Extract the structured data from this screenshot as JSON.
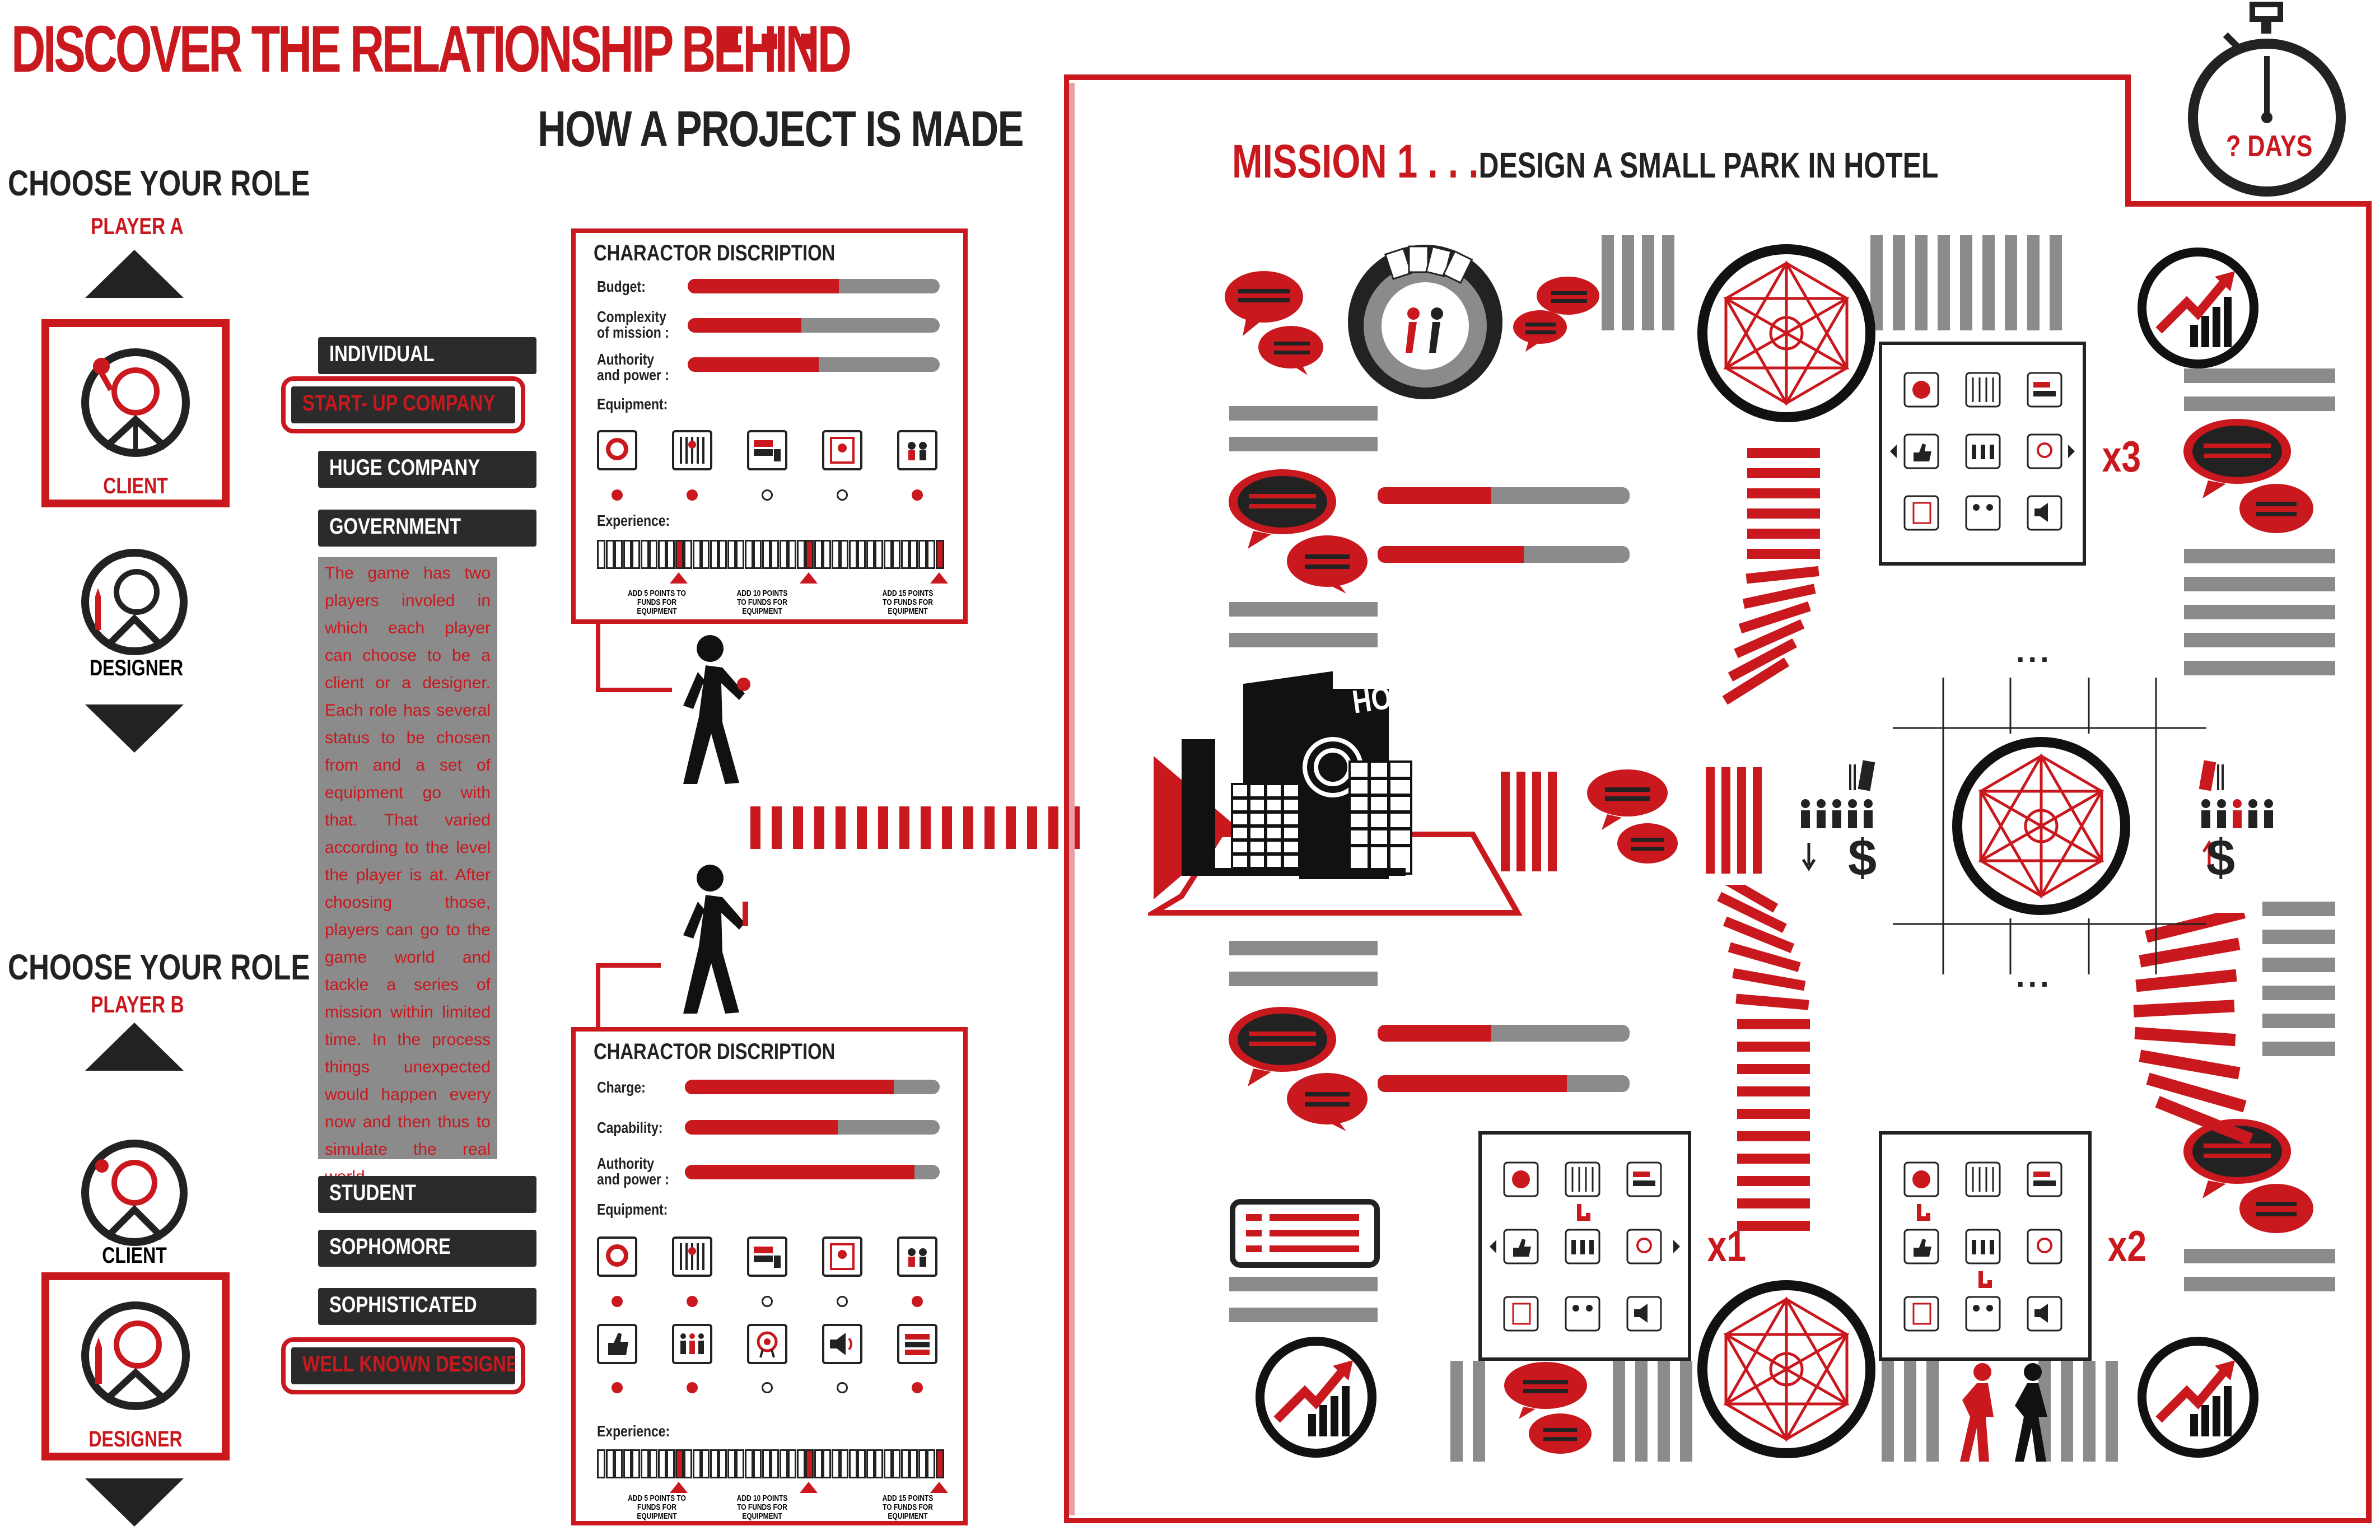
{
  "header": {
    "title": "DISCOVER THE RELATIONSHIP BEHIND",
    "subtitle": "HOW A PROJECT IS MADE"
  },
  "player_a": {
    "heading": "CHOOSE YOUR ROLE",
    "label": "PLAYER A",
    "roles": [
      {
        "label": "CLIENT",
        "selected": true
      },
      {
        "label": "DESIGNER",
        "selected": false
      }
    ],
    "statuses": [
      {
        "label": "INDIVIDUAL",
        "selected": false
      },
      {
        "label": "START- UP COMPANY",
        "selected": true
      },
      {
        "label": "HUGE COMPANY",
        "selected": false
      },
      {
        "label": "GOVERNMENT",
        "selected": false
      }
    ]
  },
  "player_b": {
    "heading": "CHOOSE YOUR ROLE",
    "label": "PLAYER B",
    "roles": [
      {
        "label": "CLIENT",
        "selected": false
      },
      {
        "label": "DESIGNER",
        "selected": true
      }
    ],
    "statuses": [
      {
        "label": "STUDENT",
        "selected": false
      },
      {
        "label": "SOPHOMORE",
        "selected": false
      },
      {
        "label": "SOPHISTICATED",
        "selected": false
      },
      {
        "label": "WELL KNOWN DESIGNER",
        "selected": true
      }
    ]
  },
  "description": "The game has two players involed in which each player can choose to be a client or a designer. Each role has several status to be chosen from and a set of equipment go with that. That varied according to the level the player is at. After choosing those, players can go to the game world and tackle a series of mission within limited time. In the process things unexpected would happen every now and then thus to simulate the real world.",
  "panel_a": {
    "title": "CHARACTOR DISCRIPTION",
    "attributes": [
      {
        "label": "Budget:",
        "value": 0.6
      },
      {
        "label": "Complexity\nof mission :",
        "value": 0.45
      },
      {
        "label": "Authority\nand power :",
        "value": 0.52
      }
    ],
    "equipment_label": "Equipment:",
    "equipment_owned": [
      true,
      true,
      false,
      false,
      true
    ],
    "experience_label": "Experience:",
    "experience_notes": [
      "ADD 5 POINTS TO FUNDS FOR EQUIPMENT",
      "ADD 10 POINTS TO FUNDS FOR EQUIPMENT",
      "ADD 15 POINTS TO FUNDS FOR EQUIPMENT"
    ]
  },
  "panel_b": {
    "title": "CHARACTOR DISCRIPTION",
    "attributes": [
      {
        "label": "Charge:",
        "value": 0.82
      },
      {
        "label": "Capability:",
        "value": 0.6
      },
      {
        "label": "Authority\nand power :",
        "value": 0.9
      }
    ],
    "equipment_label": "Equipment:",
    "equipment_owned_row1": [
      true,
      true,
      false,
      false,
      true
    ],
    "equipment_owned_row2": [
      true,
      true,
      false,
      false,
      true
    ],
    "experience_label": "Experience:",
    "experience_notes": [
      "ADD 5 POINTS TO FUNDS FOR EQUIPMENT",
      "ADD 10 POINTS TO FUNDS FOR EQUIPMENT",
      "ADD 15 POINTS TO FUNDS FOR EQUIPMENT"
    ]
  },
  "board": {
    "mission_number": "MISSION 1 . . .",
    "mission_text": "DESIGN A SMALL PARK IN HOTEL",
    "timer_label": "? DAYS",
    "hotel_sign": "HOTEL",
    "multipliers": [
      "x3",
      "x1",
      "x2"
    ],
    "ellipsis": "...",
    "currency": "$"
  },
  "colors": {
    "accent": "#c9181e",
    "dark": "#222222",
    "grey": "#8b8b8b"
  }
}
